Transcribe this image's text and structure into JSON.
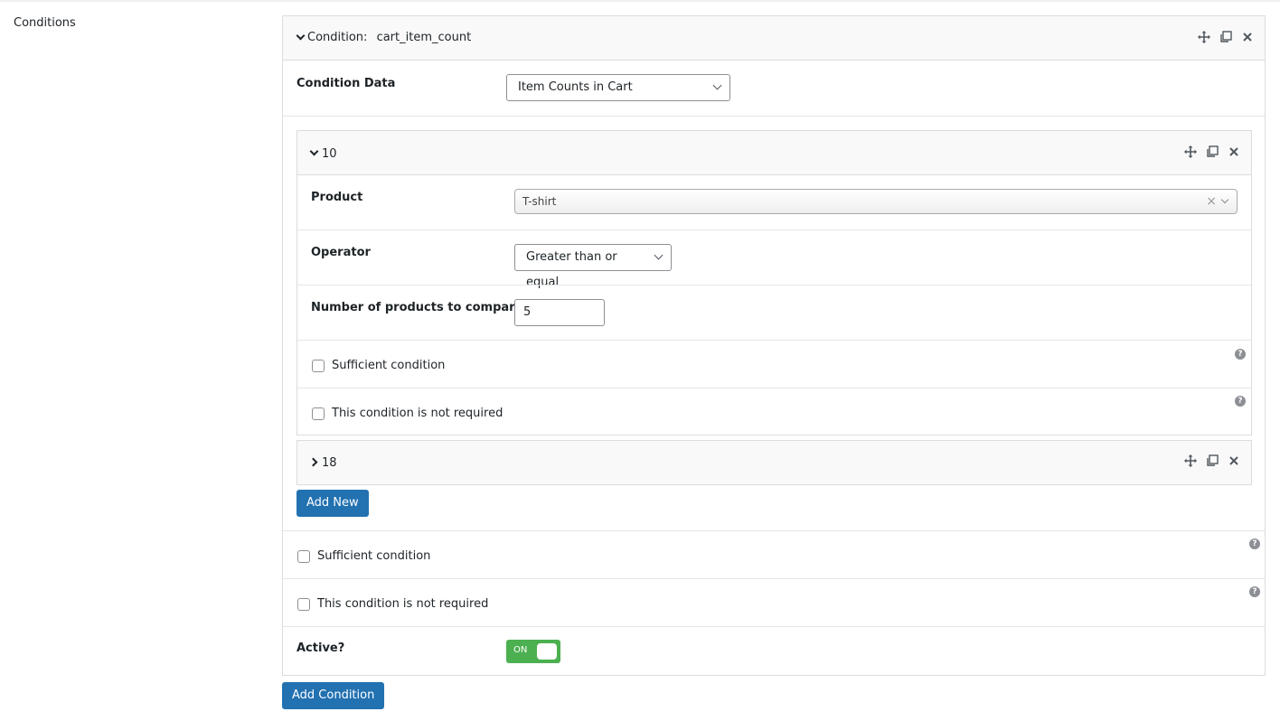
{
  "section_label": "Conditions",
  "condition": {
    "prefix": "Condition:",
    "name": "cart_item_count",
    "data_label": "Condition Data",
    "data_value": "Item Counts in Cart"
  },
  "sub1": {
    "id": "10",
    "product_label": "Product",
    "product_value": "T-shirt",
    "operator_label": "Operator",
    "operator_value": "Greater than or equal",
    "number_label": "Number of products to compare",
    "number_value": "5",
    "sufficient": "Sufficient condition",
    "not_required": "This condition is not required"
  },
  "sub2": {
    "id": "18"
  },
  "add_new": "Add New",
  "outer_sufficient": "Sufficient condition",
  "outer_not_required": "This condition is not required",
  "active_label": "Active?",
  "toggle_on": "ON",
  "add_condition": "Add Condition",
  "icons": {
    "move": "move-icon",
    "duplicate": "duplicate-icon",
    "close": "close-icon",
    "help": "help-icon"
  }
}
